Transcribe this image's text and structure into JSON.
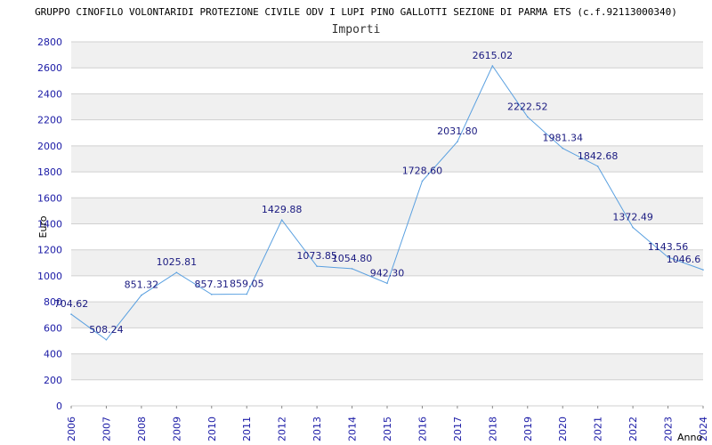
{
  "header": {
    "title": "GRUPPO CINOFILO VOLONTARIDI PROTEZIONE CIVILE ODV I LUPI PINO GALLOTTI SEZIONE DI PARMA ETS (c.f.92113000340)",
    "subtitle": "Importi"
  },
  "colors": {
    "line": "#5aa0e0",
    "band": "#f0f0f0",
    "grid": "#d0d0d0",
    "tick_text": "#1a1aa6",
    "label_text": "#1a1a80"
  },
  "chart_data": {
    "type": "line",
    "title": "GRUPPO CINOFILO VOLONTARIDI PROTEZIONE CIVILE ODV I LUPI PINO GALLOTTI SEZIONE DI PARMA ETS (c.f.92113000340)",
    "subtitle": "Importi",
    "xlabel": "Anno",
    "ylabel": "Euro",
    "x": [
      2006,
      2007,
      2008,
      2009,
      2010,
      2011,
      2012,
      2013,
      2014,
      2015,
      2016,
      2017,
      2018,
      2019,
      2020,
      2021,
      2022,
      2023,
      2024
    ],
    "values": [
      704.62,
      508.24,
      851.32,
      1025.81,
      857.31,
      859.05,
      1429.88,
      1073.85,
      1054.8,
      942.3,
      1728.6,
      2031.8,
      2615.02,
      2222.52,
      1981.34,
      1842.68,
      1372.49,
      1143.56,
      1046.6
    ],
    "value_labels": [
      "704.62",
      "508.24",
      "851.32",
      "1025.81",
      "857.31",
      "859.05",
      "1429.88",
      "1073.85",
      "1054.80",
      "942.30",
      "1728.60",
      "2031.80",
      "2615.02",
      "2222.52",
      "1981.34",
      "1842.68",
      "1372.49",
      "1143.56",
      "1046.6"
    ],
    "y_ticks": [
      0,
      200,
      400,
      600,
      800,
      1000,
      1200,
      1400,
      1600,
      1800,
      2000,
      2200,
      2400,
      2600,
      2800
    ],
    "ylim": [
      0,
      2800
    ],
    "xlim": [
      2006,
      2024
    ],
    "grid": true,
    "legend": "none"
  }
}
